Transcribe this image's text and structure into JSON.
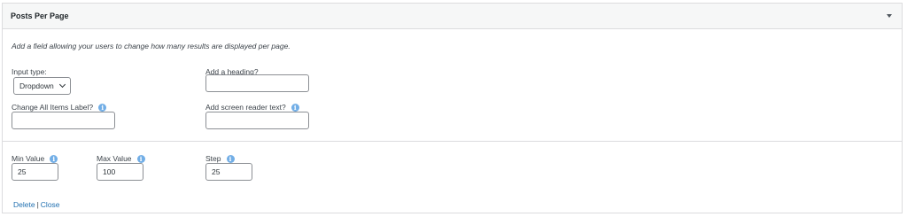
{
  "panel": {
    "title": "Posts Per Page",
    "description": "Add a field allowing your users to change how many results are displayed per page."
  },
  "fields": {
    "input_type": {
      "label": "Input type:",
      "value": "Dropdown"
    },
    "heading": {
      "label": "Add a heading?",
      "value": ""
    },
    "all_items_label": {
      "label": "Change All Items Label?",
      "value": ""
    },
    "screen_reader": {
      "label": "Add screen reader text?",
      "value": ""
    },
    "min_value": {
      "label": "Min Value",
      "value": "25"
    },
    "max_value": {
      "label": "Max Value",
      "value": "100"
    },
    "step": {
      "label": "Step",
      "value": "25"
    }
  },
  "actions": {
    "delete": "Delete",
    "separator": "|",
    "close": "Close"
  },
  "icons": {
    "info": "info-icon",
    "toggle": "triangle-down-icon",
    "select": "chevron-down-icon"
  },
  "colors": {
    "link": "#2271b1",
    "info_icon": "#72aee6",
    "header_bg": "#f6f7f7",
    "border": "#dcdcde"
  }
}
